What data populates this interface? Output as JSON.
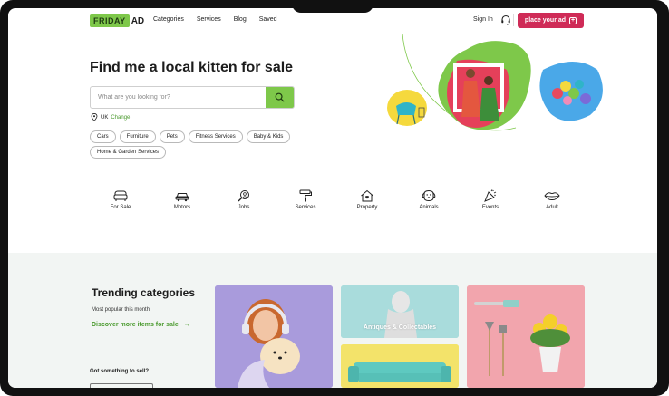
{
  "header": {
    "logo_friday": "FRIDAY",
    "logo_ad": "AD",
    "nav": [
      "Categories",
      "Services",
      "Blog",
      "Saved"
    ],
    "sign_in": "Sign In",
    "place_ad": "place your ad"
  },
  "hero": {
    "title": "Find me a local kitten for sale",
    "search_placeholder": "What are you looking for?",
    "location": "UK",
    "location_change": "Change",
    "chips": [
      "Cars",
      "Furniture",
      "Pets",
      "Fitness Services",
      "Baby & Kids",
      "Home & Garden Services"
    ]
  },
  "categories": [
    {
      "label": "For Sale",
      "icon": "sofa-icon"
    },
    {
      "label": "Motors",
      "icon": "car-icon"
    },
    {
      "label": "Jobs",
      "icon": "magnifier-person-icon"
    },
    {
      "label": "Services",
      "icon": "paint-roller-icon"
    },
    {
      "label": "Property",
      "icon": "house-icon"
    },
    {
      "label": "Animals",
      "icon": "dog-icon"
    },
    {
      "label": "Events",
      "icon": "party-icon"
    },
    {
      "label": "Adult",
      "icon": "lips-icon"
    }
  ],
  "trending": {
    "title": "Trending categories",
    "subtitle": "Most popular this month",
    "link": "Discover more items for sale",
    "sell_question": "Got something to sell?",
    "cards": [
      {
        "label": ""
      },
      {
        "label": "Antiques & Collectables"
      },
      {
        "label": ""
      },
      {
        "label": ""
      }
    ]
  },
  "colors": {
    "brand_green": "#7ec84a",
    "accent_red": "#cf2b57",
    "link_green": "#4a9a2e",
    "section_bg": "#f2f5f3"
  }
}
